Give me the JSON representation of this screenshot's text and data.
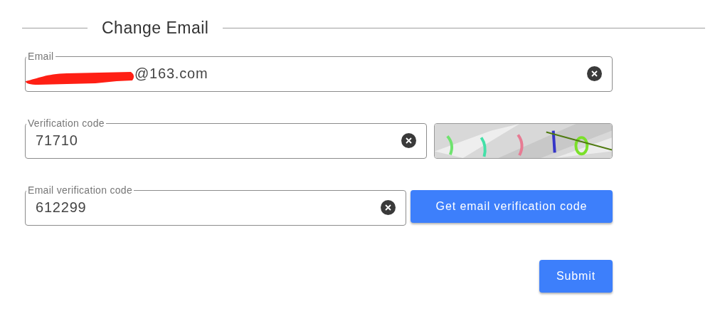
{
  "section": {
    "title": "Change Email"
  },
  "fields": [
    {
      "kind": "text",
      "label": "Email",
      "value": "@163.com",
      "redacted": true
    },
    {
      "kind": "captcha",
      "label": "Verification code",
      "value": "71710"
    },
    {
      "kind": "action",
      "label": "Email verification code",
      "value": "612299",
      "button": "Get email verification code"
    }
  ],
  "submit": "Submit"
}
